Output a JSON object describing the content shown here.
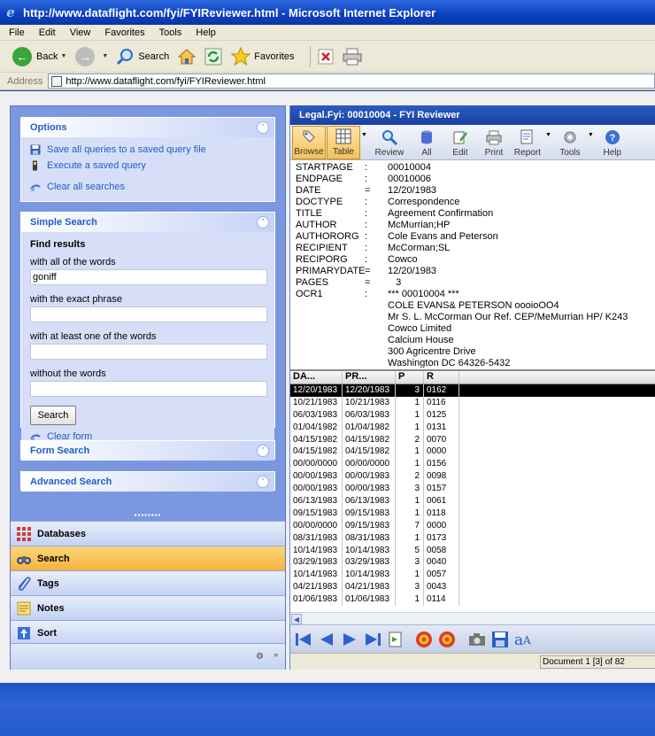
{
  "window": {
    "title": "http://www.dataflight.com/fyi/FYIReviewer.html - Microsoft Internet Explorer"
  },
  "menu": [
    "File",
    "Edit",
    "View",
    "Favorites",
    "Tools",
    "Help"
  ],
  "ie_toolbar": {
    "back": "Back",
    "search": "Search",
    "favorites": "Favorites"
  },
  "address": {
    "label": "Address",
    "url": "http://www.dataflight.com/fyi/FYIReviewer.html"
  },
  "options": {
    "title": "Options",
    "items": [
      "Save all queries to a saved query file",
      "Execute a saved query",
      "Clear all searches"
    ]
  },
  "simple_search": {
    "title": "Simple Search",
    "find_results": "Find results",
    "all_words_label": "with all of the words",
    "all_words_value": "goniff",
    "exact_label": "with the exact phrase",
    "exact_value": "",
    "any_label": "with at least one of the words",
    "any_value": "",
    "without_label": "without the words",
    "without_value": "",
    "search_button": "Search",
    "clear_form": "Clear form"
  },
  "form_search": {
    "title": "Form Search"
  },
  "advanced_search": {
    "title": "Advanced Search"
  },
  "nav_items": [
    "Databases",
    "Search",
    "Tags",
    "Notes",
    "Sort"
  ],
  "active_nav": "Search",
  "reviewer": {
    "title": "Legal.Fyi: 00010004 - FYI Reviewer",
    "toolbar": [
      "Browse",
      "Table",
      "Review",
      "All",
      "Edit",
      "Print",
      "Report",
      "Tools",
      "Help"
    ]
  },
  "detail": {
    "fields": [
      {
        "key": "STARTPAGE",
        "sep": ":",
        "value": "00010004"
      },
      {
        "key": "ENDPAGE",
        "sep": ":",
        "value": "00010006"
      },
      {
        "key": "DATE",
        "sep": "=",
        "value": "12/20/1983"
      },
      {
        "key": "DOCTYPE",
        "sep": ":",
        "value": "Correspondence"
      },
      {
        "key": "TITLE",
        "sep": ":",
        "value": "Agreement Confirmation"
      },
      {
        "key": "AUTHOR",
        "sep": ":",
        "value": "McMurrian;HP"
      },
      {
        "key": "AUTHORORG",
        "sep": ":",
        "value": "Cole Evans and Peterson"
      },
      {
        "key": "RECIPIENT",
        "sep": ":",
        "value": "McCorman;SL"
      },
      {
        "key": "RECIPORG",
        "sep": ":",
        "value": "Cowco"
      },
      {
        "key": "PRIMARYDATE",
        "sep": "=",
        "value": "12/20/1983"
      },
      {
        "key": "PAGES",
        "sep": "=",
        "value": "   3"
      },
      {
        "key": "OCR1",
        "sep": ":",
        "value": "*** 00010004 ***"
      }
    ],
    "ocr_lines": [
      "COLE EVANS& PETERSON oooioOO4",
      "Mr S. L. McCorman Our Ref. CEP/MeMurrian HP/ K243",
      "Cowco Limited",
      "Calcium House",
      "300 Agricentre Drive",
      "Washington DC 64326-5432"
    ]
  },
  "grid": {
    "headers": [
      "DA...",
      "PR...",
      "P",
      "R"
    ],
    "rows": [
      [
        "12/20/1983",
        "12/20/1983",
        "3",
        "0162"
      ],
      [
        "10/21/1983",
        "10/21/1983",
        "1",
        "0116"
      ],
      [
        "06/03/1983",
        "06/03/1983",
        "1",
        "0125"
      ],
      [
        "01/04/1982",
        "01/04/1982",
        "1",
        "0131"
      ],
      [
        "04/15/1982",
        "04/15/1982",
        "2",
        "0070"
      ],
      [
        "04/15/1982",
        "04/15/1982",
        "1",
        "0000"
      ],
      [
        "00/00/0000",
        "00/00/0000",
        "1",
        "0156"
      ],
      [
        "00/00/1983",
        "00/00/1983",
        "2",
        "0098"
      ],
      [
        "00/00/1983",
        "00/00/1983",
        "3",
        "0157"
      ],
      [
        "06/13/1983",
        "06/13/1983",
        "1",
        "0061"
      ],
      [
        "09/15/1983",
        "09/15/1983",
        "1",
        "0118"
      ],
      [
        "00/00/0000",
        "09/15/1983",
        "7",
        "0000"
      ],
      [
        "08/31/1983",
        "08/31/1983",
        "1",
        "0173"
      ],
      [
        "10/14/1983",
        "10/14/1983",
        "5",
        "0058"
      ],
      [
        "03/29/1983",
        "03/29/1983",
        "3",
        "0040"
      ],
      [
        "10/14/1983",
        "10/14/1983",
        "1",
        "0057"
      ],
      [
        "04/21/1983",
        "04/21/1983",
        "3",
        "0043"
      ],
      [
        "01/06/1983",
        "01/06/1983",
        "1",
        "0114"
      ]
    ],
    "selected_row": 0
  },
  "status": {
    "document": "Document 1 [3] of 82"
  }
}
